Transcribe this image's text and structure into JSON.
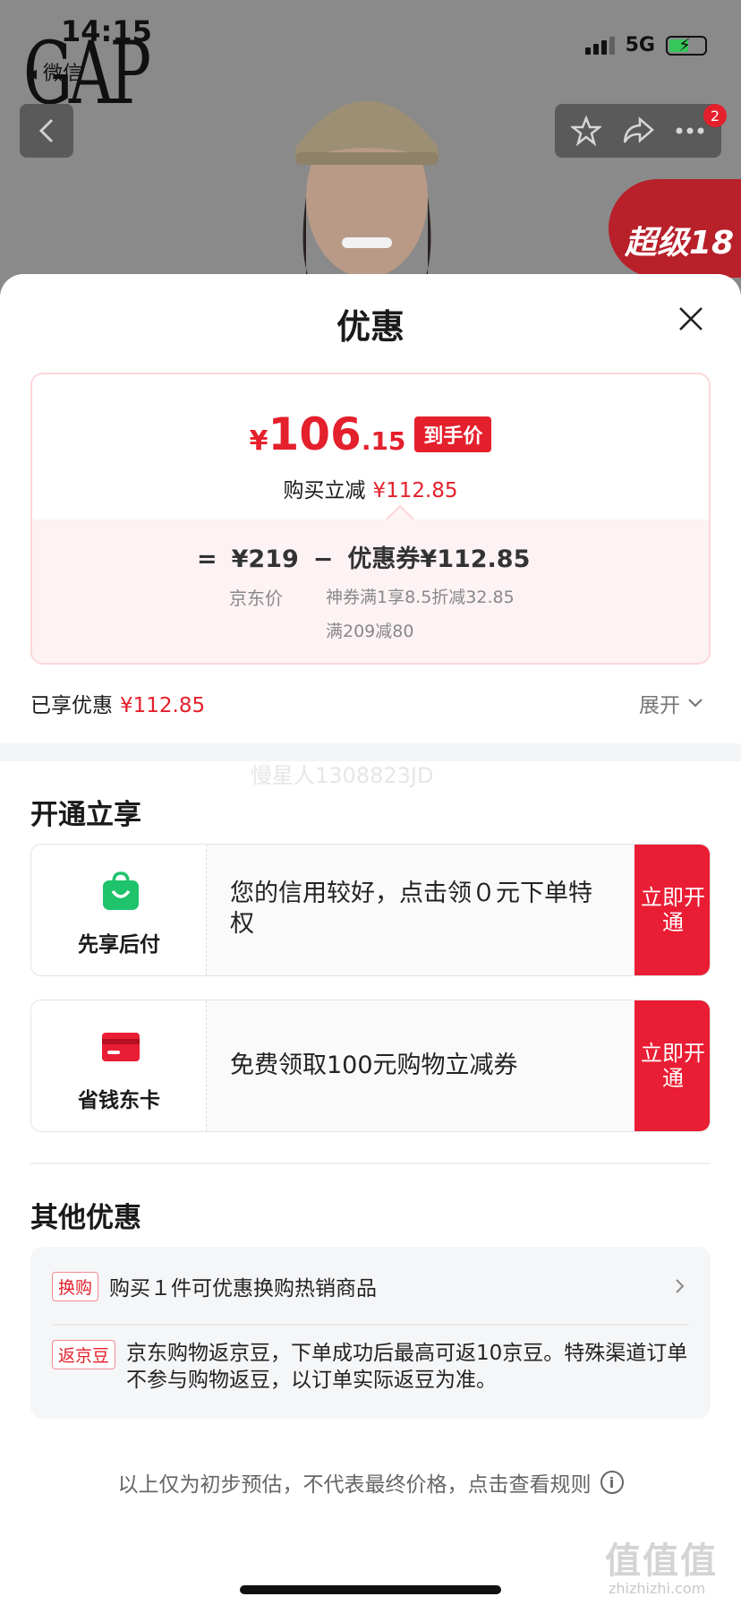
{
  "status_bar": {
    "time": "14:15",
    "back_label": "◂ 微信",
    "network": "5G"
  },
  "product_bg": {
    "brand": "GAP",
    "promo_text": "超级18",
    "more_badge": "2"
  },
  "sheet": {
    "title": "优惠",
    "price": {
      "currency": "¥",
      "integer": "106",
      "decimal": ".15",
      "tag": "到手价"
    },
    "buy_reduce": {
      "label": "购买立减",
      "amount": "¥112.85"
    },
    "formula": {
      "equals": "=",
      "jd_price": "¥219",
      "minus": "−",
      "coupon": "优惠券¥112.85"
    },
    "jd_price_label": "京东价",
    "coupon_details": [
      "神券满1享8.5折减32.85",
      "满209减80"
    ],
    "enjoyed": {
      "label": "已享优惠",
      "amount": "¥112.85"
    },
    "expand_label": "展开",
    "watermark": "慢星人1308823JD"
  },
  "open_section": {
    "title": "开通立享",
    "cards": [
      {
        "name": "先享后付",
        "icon": "shopping-bag-icon",
        "desc": "您的信用较好，点击领０元下单特权",
        "button": "立即开通"
      },
      {
        "name": "省钱东卡",
        "icon": "card-icon",
        "desc": "免费领取100元购物立减券",
        "button": "立即开通"
      }
    ]
  },
  "other_section": {
    "title": "其他优惠",
    "items": [
      {
        "tag": "换购",
        "text": "购买１件可优惠换购热销商品"
      },
      {
        "tag": "返京豆",
        "text": "京东购物返京豆，下单成功后最高可返10京豆。特殊渠道订单不参与购物返豆，以订单实际返豆为准。"
      }
    ]
  },
  "disclaimer": "以上仅为初步预估，不代表最终价格，点击查看规则",
  "corner_watermark": {
    "mark": "值值值",
    "url": "zhizhizhi.com"
  },
  "colors": {
    "accent_red": "#e4202c",
    "button_red": "#e91d34",
    "green": "#1fc36b"
  }
}
